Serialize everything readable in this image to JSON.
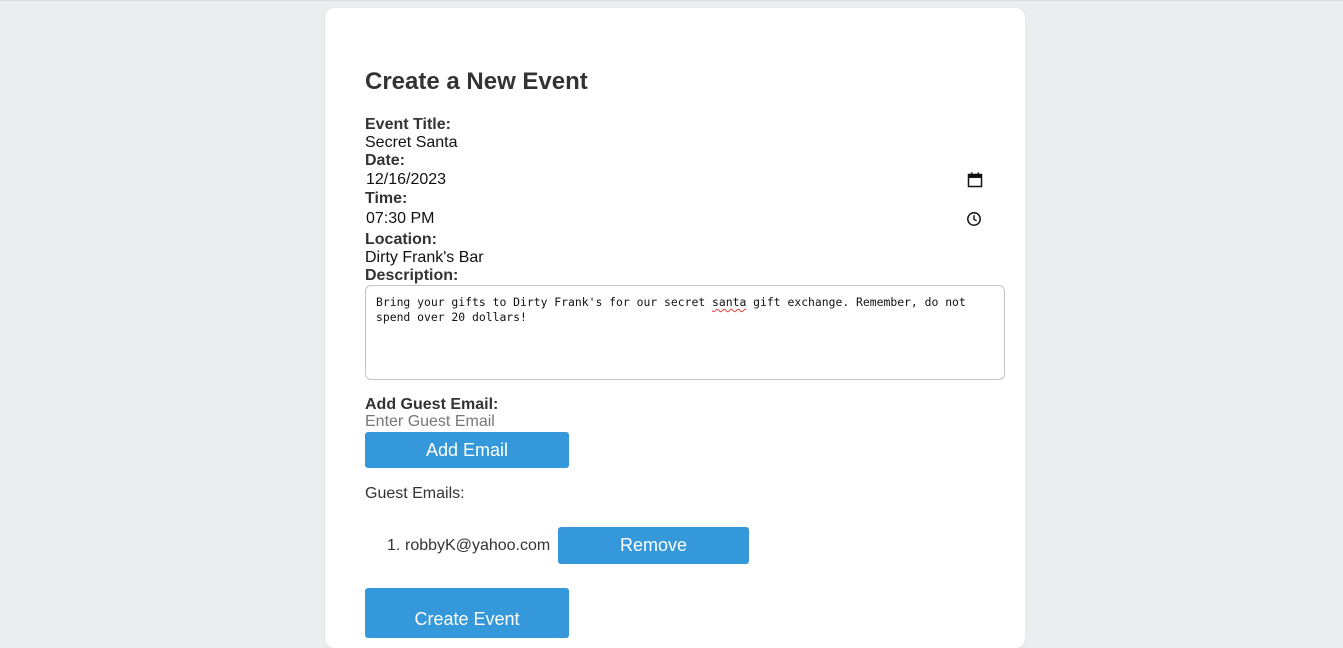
{
  "form": {
    "title": "Create a New Event",
    "event_title_label": "Event Title:",
    "event_title_value": "Secret Santa",
    "date_label": "Date:",
    "date_value": "12/16/2023",
    "time_label": "Time:",
    "time_value": "07:30 PM",
    "location_label": "Location:",
    "location_value": "Dirty Frank's Bar",
    "description_label": "Description:",
    "description_before": "Bring your gifts to Dirty Frank's for our secret ",
    "description_misspelled": "santa",
    "description_after": " gift exchange. Remember, do not spend over 20 dollars!",
    "guest_email_label": "Add Guest Email:",
    "guest_email_placeholder": "Enter Guest Email",
    "add_email_button": "Add Email",
    "guest_emails_heading": "Guest Emails:",
    "guest_emails": [
      {
        "number": "1.",
        "email": "robbyK@yahoo.com",
        "remove_label": "Remove"
      }
    ],
    "create_event_button": "Create Event"
  },
  "icons": {
    "date_picker": "calendar-icon",
    "time_picker": "clock-icon"
  },
  "colors": {
    "accent": "#3498db",
    "page_background": "#ebeeef",
    "card_background": "#ffffff",
    "spellcheck_underline": "#e0443e"
  }
}
